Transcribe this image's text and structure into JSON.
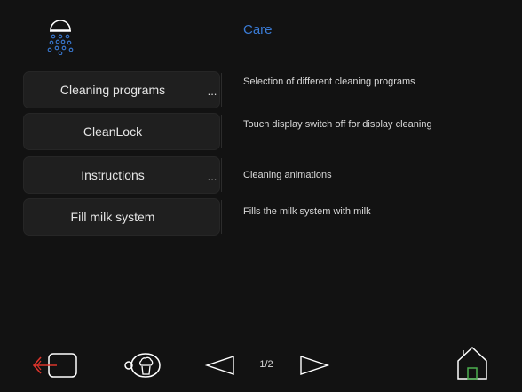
{
  "header": {
    "title": "Care",
    "icon": "shower-head-icon"
  },
  "menu": {
    "items": [
      {
        "label": "Cleaning programs",
        "more": "...",
        "description": "Selection of different cleaning programs"
      },
      {
        "label": "CleanLock",
        "description": "Touch display switch off for display cleaning"
      },
      {
        "label": "Instructions",
        "more": "...",
        "description": "Cleaning animations"
      },
      {
        "label": "Fill milk system",
        "description": "Fills the milk system with milk"
      }
    ]
  },
  "footer": {
    "page_indicator": "1/2",
    "icons": [
      "exit-icon",
      "coffee-cup-icon",
      "previous-page-icon",
      "next-page-icon",
      "home-icon"
    ]
  },
  "colors": {
    "background": "#121212",
    "accent_blue": "#3a7bd5",
    "exit_red": "#d9342b",
    "home_green": "#4caf50"
  }
}
